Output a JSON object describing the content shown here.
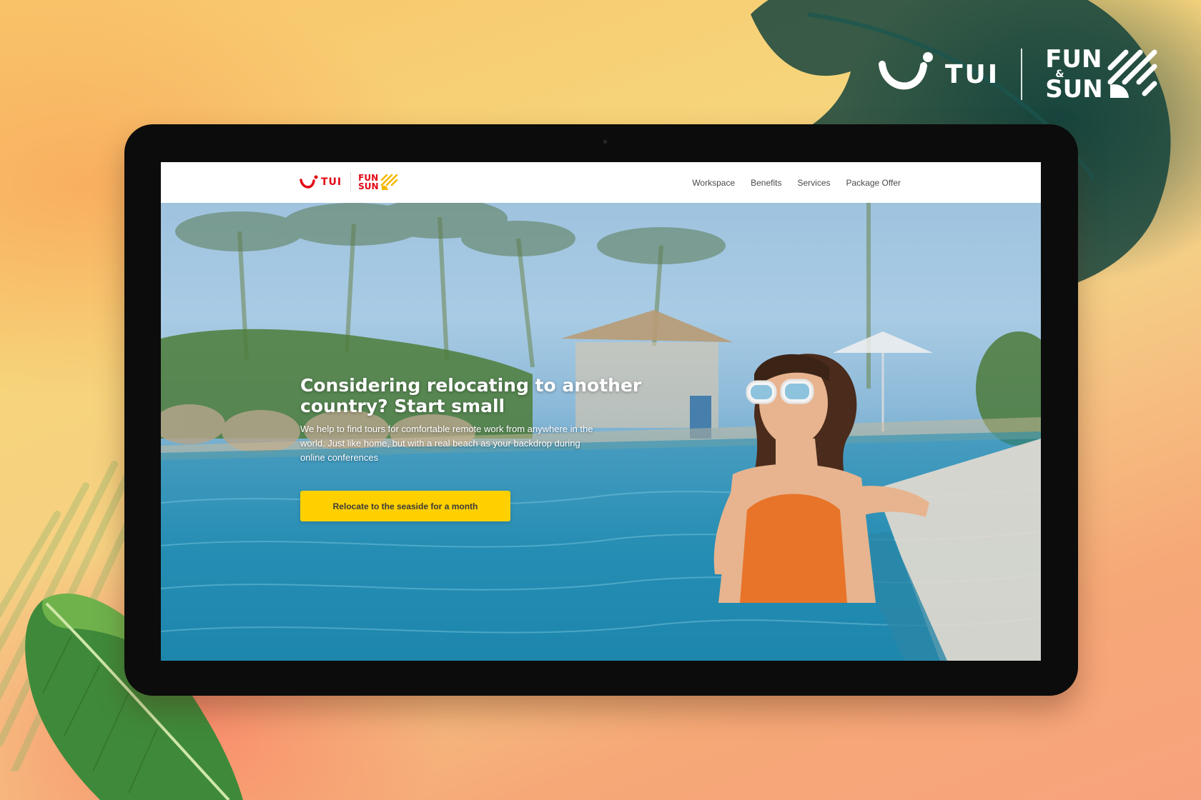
{
  "brand": {
    "tui": "TUI",
    "fun": "FUN",
    "amp": "&",
    "sun": "SUN"
  },
  "site": {
    "logo": {
      "tui": "TUI",
      "fun": "FUN",
      "amp": "&",
      "sun": "SUN"
    },
    "nav": [
      {
        "label": "Workspace"
      },
      {
        "label": "Benefits"
      },
      {
        "label": "Services"
      },
      {
        "label": "Package Offer"
      }
    ]
  },
  "hero": {
    "title": "Considering relocating to another country? Start small",
    "subtitle": "We help to find tours for comfortable remote work from anywhere in the world. Just like home, but with a real beach as your backdrop during online conferences",
    "cta_label": "Relocate to the seaside for a month"
  },
  "colors": {
    "brand_red": "#e30613",
    "cta_yellow": "#ffd000"
  }
}
